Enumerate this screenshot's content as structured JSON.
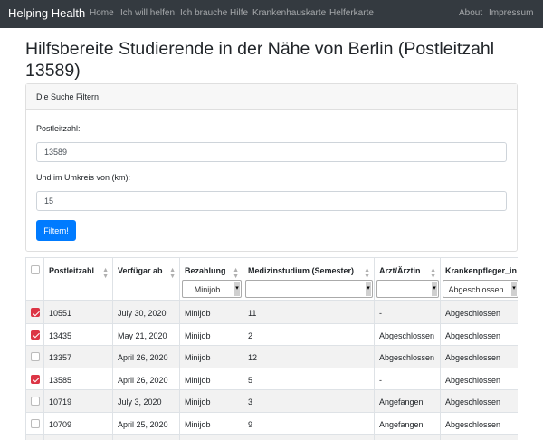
{
  "navbar": {
    "brand": "Helping Health",
    "links": [
      "Home",
      "Ich will helfen",
      "Ich brauche Hilfe",
      "Krankenhauskarte",
      "Helferkarte"
    ],
    "right_links": [
      "About",
      "Impressum"
    ],
    "bg_color": "#343a40"
  },
  "page": {
    "title": "Hilfsbereite Studierende in der Nähe von Berlin (Postleitzahl 13589)"
  },
  "filter": {
    "header": "Die Suche Filtern",
    "postcode_label": "Postleitzahl:",
    "postcode_value": "13589",
    "radius_label": "Und im Umkreis von (km):",
    "radius_value": "15",
    "submit_label": "Filtern!",
    "accent_color": "#007bff"
  },
  "table": {
    "columns": [
      "Postleitzahl",
      "Verfügar ab",
      "Bezahlung",
      "Medizinstudium (Semester)",
      "Arzt/Ärztin",
      "Krankenpfleger_in"
    ],
    "filters": {
      "bezahlung": "Minijob",
      "medizinstudium": "",
      "arzt": "",
      "krankenpfleger": "Abgeschlossen"
    },
    "rows": [
      {
        "checked": true,
        "plz": "10551",
        "date": "July 30, 2020",
        "pay": "Minijob",
        "semester": "11",
        "arzt": "-",
        "pflege": "Abgeschlossen"
      },
      {
        "checked": true,
        "plz": "13435",
        "date": "May 21, 2020",
        "pay": "Minijob",
        "semester": "2",
        "arzt": "Abgeschlossen",
        "pflege": "Abgeschlossen"
      },
      {
        "checked": false,
        "plz": "13357",
        "date": "April 26, 2020",
        "pay": "Minijob",
        "semester": "12",
        "arzt": "Abgeschlossen",
        "pflege": "Abgeschlossen"
      },
      {
        "checked": true,
        "plz": "13585",
        "date": "April 26, 2020",
        "pay": "Minijob",
        "semester": "5",
        "arzt": "-",
        "pflege": "Abgeschlossen"
      },
      {
        "checked": false,
        "plz": "10719",
        "date": "July 3, 2020",
        "pay": "Minijob",
        "semester": "3",
        "arzt": "Angefangen",
        "pflege": "Abgeschlossen"
      },
      {
        "checked": false,
        "plz": "10709",
        "date": "April 25, 2020",
        "pay": "Minijob",
        "semester": "9",
        "arzt": "Angefangen",
        "pflege": "Abgeschlossen"
      },
      {
        "checked": false,
        "plz": "",
        "date": "",
        "pay": "",
        "semester": "",
        "arzt": "",
        "pflege": ""
      }
    ],
    "check_color": "#dc3545",
    "stripe_color": "#f2f2f2"
  }
}
